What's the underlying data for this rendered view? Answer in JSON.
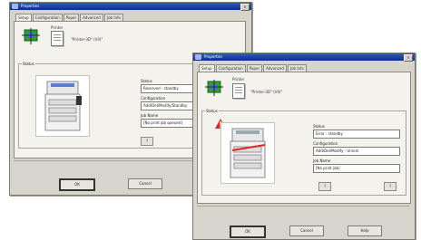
{
  "window_back": {
    "title": "Properties",
    "tabs": [
      "Setup",
      "Configuration",
      "Paper",
      "Advanced",
      "Job Info"
    ],
    "active_tab": 0,
    "printer_label": "Printer",
    "printer_name": "\"Printer-3D\" (V4)\"",
    "group_label": "Status",
    "fields": [
      {
        "label": "Status",
        "value": "Reserved - standby"
      },
      {
        "label": "Configuration",
        "value": "Add/Del/Modify/Standby"
      },
      {
        "label": "Job Name",
        "value": "[No print job queued]"
      }
    ],
    "help_small": "?",
    "buttons": {
      "ok": "OK",
      "cancel": "Cancel"
    }
  },
  "window_front": {
    "title": "Properties",
    "tabs": [
      "Setup",
      "Configuration",
      "Paper",
      "Advanced",
      "Job Info"
    ],
    "active_tab": 0,
    "printer_label": "Printer",
    "printer_name": "\"Printer-3D\" (V4)\"",
    "group_label": "Status",
    "fields": [
      {
        "label": "Status",
        "value": "Error - standby"
      },
      {
        "label": "Configuration",
        "value": "Add/Del/Modify - Uninst"
      },
      {
        "label": "Job Name",
        "value": "[No print job]"
      }
    ],
    "help_small": "?",
    "help_small_2": "?",
    "buttons": {
      "ok": "OK",
      "cancel": "Cancel",
      "help": "Help"
    }
  }
}
